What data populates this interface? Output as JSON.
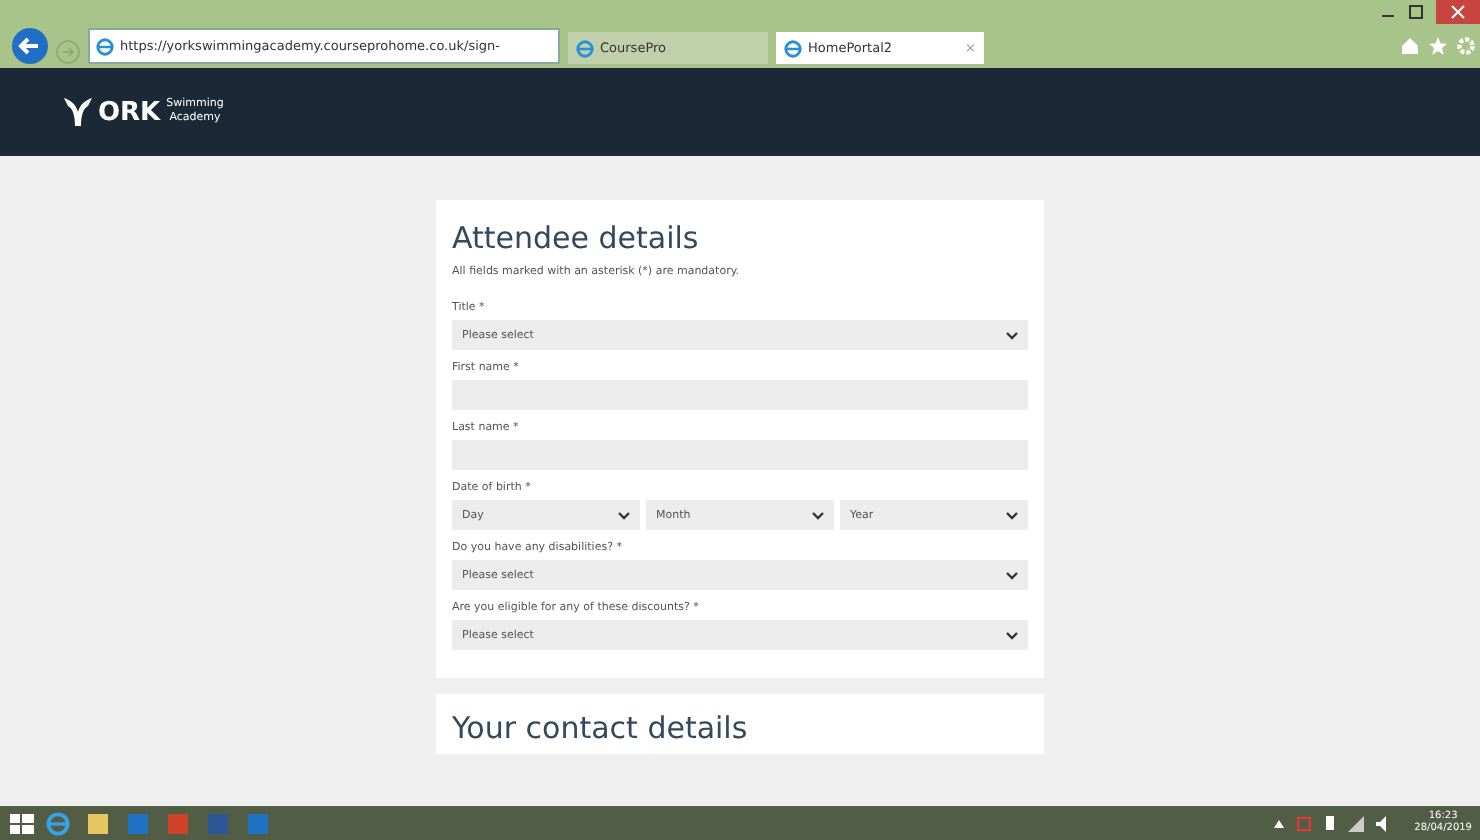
{
  "browser": {
    "url": "https://yorkswimmingacademy.courseprohome.co.uk/sign-",
    "tabs": [
      {
        "label": "CoursePro",
        "selected": false
      },
      {
        "label": "HomePortal2",
        "selected": true,
        "close": "×"
      }
    ]
  },
  "header": {
    "logo_main": "ORK",
    "logo_sub_1": "Swimming",
    "logo_sub_2": "Academy"
  },
  "form": {
    "title": "Attendee details",
    "note": "All fields marked with an asterisk (*) are mandatory.",
    "fields": [
      {
        "kind": "select",
        "label": "Title *",
        "value": "Please select"
      },
      {
        "kind": "text",
        "label": "First name *"
      },
      {
        "kind": "text",
        "label": "Last name *"
      },
      {
        "kind": "date",
        "label": "Date of birth *",
        "parts": [
          "Day",
          "Month",
          "Year"
        ]
      },
      {
        "kind": "select",
        "label": "Do you have any disabilities? *",
        "value": "Please select"
      },
      {
        "kind": "select",
        "label": "Are you eligible for any of these discounts? *",
        "value": "Please select"
      }
    ]
  },
  "next_section": {
    "title": "Your contact details"
  },
  "taskbar": {
    "time": "16:23",
    "date": "28/04/2019"
  }
}
